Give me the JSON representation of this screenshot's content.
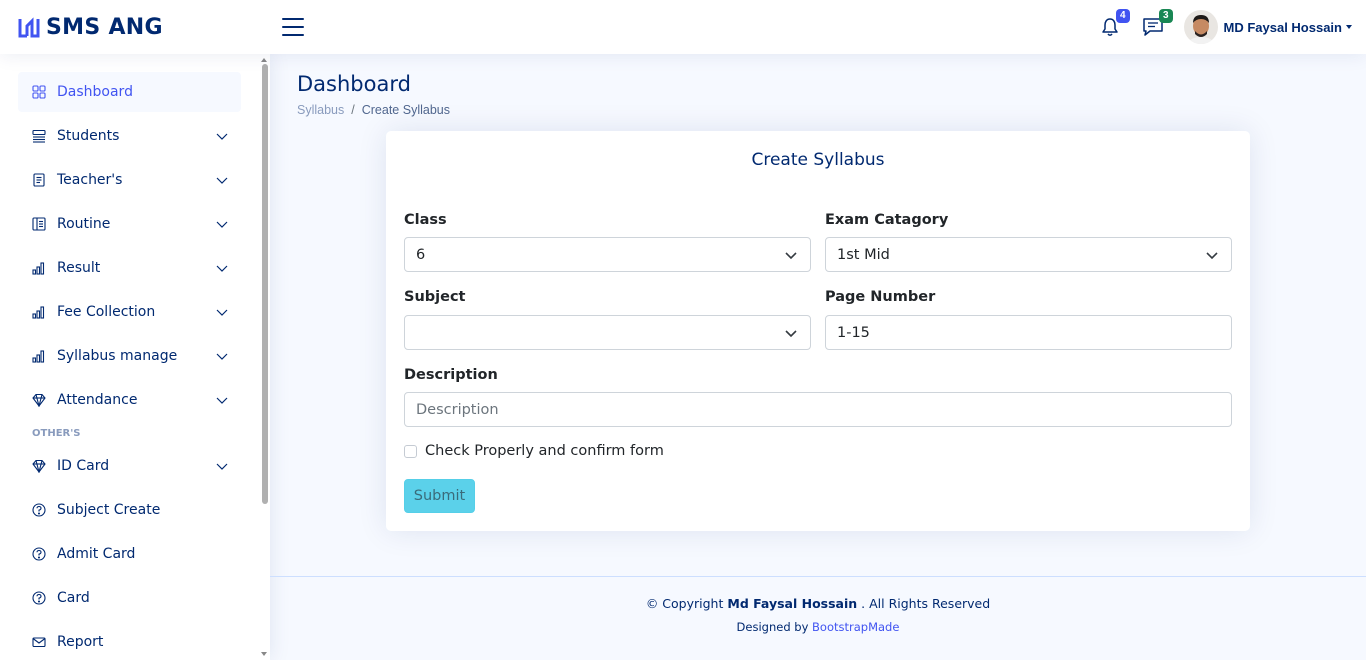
{
  "header": {
    "logo_text": "SMS ANG",
    "notifications": {
      "icon": "bell-icon",
      "count": "4"
    },
    "messages": {
      "icon": "chat-icon",
      "count": "3"
    },
    "profile_name": "MD Faysal Hossain"
  },
  "sidebar": {
    "items": [
      {
        "label": "Dashboard",
        "icon": "grid-icon",
        "active": true,
        "expandable": false
      },
      {
        "label": "Students",
        "icon": "menu-button-icon",
        "expandable": true
      },
      {
        "label": "Teacher's",
        "icon": "journal-icon",
        "expandable": true
      },
      {
        "label": "Routine",
        "icon": "layout-text-icon",
        "expandable": true
      },
      {
        "label": "Result",
        "icon": "bar-chart-icon",
        "expandable": true
      },
      {
        "label": "Fee Collection",
        "icon": "bar-chart-icon",
        "expandable": true
      },
      {
        "label": "Syllabus manage",
        "icon": "bar-chart-icon",
        "expandable": true
      },
      {
        "label": "Attendance",
        "icon": "gem-icon",
        "expandable": true
      }
    ],
    "others_heading": "OTHER'S",
    "other_items": [
      {
        "label": "ID Card",
        "icon": "gem-icon",
        "expandable": true
      },
      {
        "label": "Subject Create",
        "icon": "question-circle-icon",
        "expandable": false
      },
      {
        "label": "Admit Card",
        "icon": "question-circle-icon",
        "expandable": false
      },
      {
        "label": "Card",
        "icon": "question-circle-icon",
        "expandable": false
      },
      {
        "label": "Report",
        "icon": "envelope-icon",
        "expandable": false
      }
    ]
  },
  "page": {
    "title": "Dashboard",
    "breadcrumb": [
      "Syllabus",
      "Create Syllabus"
    ]
  },
  "form": {
    "title": "Create Syllabus",
    "class_label": "Class",
    "class_value": "6",
    "exam_label": "Exam Catagory",
    "exam_value": "1st Mid",
    "subject_label": "Subject",
    "subject_value": "",
    "page_label": "Page Number",
    "page_value": "1-15",
    "description_label": "Description",
    "description_placeholder": "Description",
    "confirm_label": "Check Properly and confirm form",
    "submit_label": "Submit"
  },
  "footer": {
    "copyright_prefix": "© Copyright",
    "copyright_name": "Md Faysal Hossain",
    "copyright_suffix": ". All Rights Reserved",
    "designed_by": "Designed by",
    "designer": "BootstrapMade"
  },
  "colors": {
    "primary": "#4154f1",
    "navy": "#012970",
    "background": "#f6f9ff",
    "submit_button": "#5bd1ea",
    "message_badge": "#198754"
  }
}
